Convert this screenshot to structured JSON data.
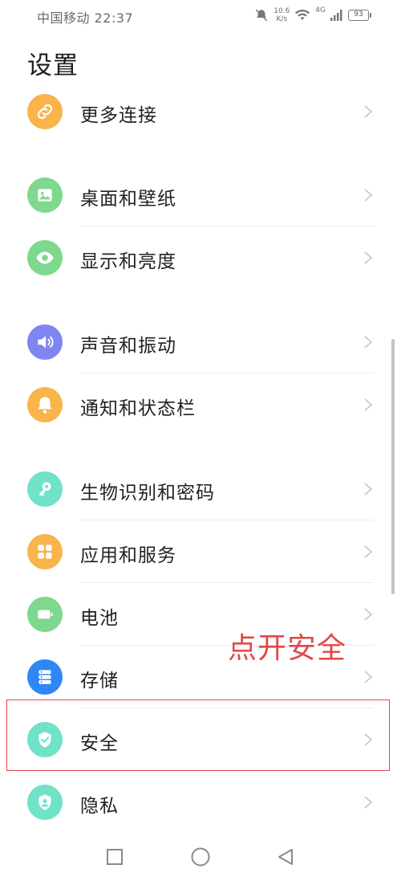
{
  "status_bar": {
    "carrier_time": "中国移动 22:37",
    "speed_value": "10.6",
    "speed_unit": "K/s",
    "network": "4G",
    "battery": "93"
  },
  "page": {
    "title": "设置"
  },
  "items": [
    {
      "label": "更多连接",
      "icon": "link-icon",
      "color": "#f9b44c"
    },
    {
      "label": "桌面和壁纸",
      "icon": "image-icon",
      "color": "#7ed88e"
    },
    {
      "label": "显示和亮度",
      "icon": "eye-icon",
      "color": "#7ed88e"
    },
    {
      "label": "声音和振动",
      "icon": "speaker-icon",
      "color": "#7f85f1"
    },
    {
      "label": "通知和状态栏",
      "icon": "bell-icon",
      "color": "#f9b44c"
    },
    {
      "label": "生物识别和密码",
      "icon": "key-icon",
      "color": "#6fe2c8"
    },
    {
      "label": "应用和服务",
      "icon": "grid-icon",
      "color": "#f9b44c"
    },
    {
      "label": "电池",
      "icon": "battery-icon",
      "color": "#7ed88e"
    },
    {
      "label": "存储",
      "icon": "storage-icon",
      "color": "#2f86f5"
    },
    {
      "label": "安全",
      "icon": "shield-icon",
      "color": "#6fe2c8"
    },
    {
      "label": "隐私",
      "icon": "privacy-icon",
      "color": "#6fe2c8"
    }
  ],
  "annotation": {
    "text": "点开安全",
    "color": "#e14747"
  }
}
